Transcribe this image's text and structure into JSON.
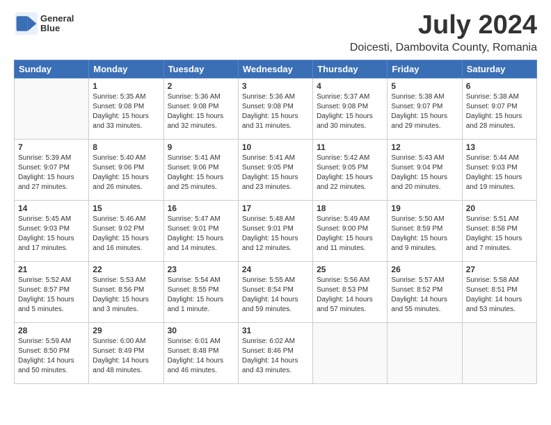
{
  "header": {
    "logo_line1": "General",
    "logo_line2": "Blue",
    "title": "July 2024",
    "subtitle": "Doicesti, Dambovita County, Romania"
  },
  "weekdays": [
    "Sunday",
    "Monday",
    "Tuesday",
    "Wednesday",
    "Thursday",
    "Friday",
    "Saturday"
  ],
  "weeks": [
    [
      {
        "day": "",
        "info": ""
      },
      {
        "day": "1",
        "info": "Sunrise: 5:35 AM\nSunset: 9:08 PM\nDaylight: 15 hours\nand 33 minutes."
      },
      {
        "day": "2",
        "info": "Sunrise: 5:36 AM\nSunset: 9:08 PM\nDaylight: 15 hours\nand 32 minutes."
      },
      {
        "day": "3",
        "info": "Sunrise: 5:36 AM\nSunset: 9:08 PM\nDaylight: 15 hours\nand 31 minutes."
      },
      {
        "day": "4",
        "info": "Sunrise: 5:37 AM\nSunset: 9:08 PM\nDaylight: 15 hours\nand 30 minutes."
      },
      {
        "day": "5",
        "info": "Sunrise: 5:38 AM\nSunset: 9:07 PM\nDaylight: 15 hours\nand 29 minutes."
      },
      {
        "day": "6",
        "info": "Sunrise: 5:38 AM\nSunset: 9:07 PM\nDaylight: 15 hours\nand 28 minutes."
      }
    ],
    [
      {
        "day": "7",
        "info": "Sunrise: 5:39 AM\nSunset: 9:07 PM\nDaylight: 15 hours\nand 27 minutes."
      },
      {
        "day": "8",
        "info": "Sunrise: 5:40 AM\nSunset: 9:06 PM\nDaylight: 15 hours\nand 26 minutes."
      },
      {
        "day": "9",
        "info": "Sunrise: 5:41 AM\nSunset: 9:06 PM\nDaylight: 15 hours\nand 25 minutes."
      },
      {
        "day": "10",
        "info": "Sunrise: 5:41 AM\nSunset: 9:05 PM\nDaylight: 15 hours\nand 23 minutes."
      },
      {
        "day": "11",
        "info": "Sunrise: 5:42 AM\nSunset: 9:05 PM\nDaylight: 15 hours\nand 22 minutes."
      },
      {
        "day": "12",
        "info": "Sunrise: 5:43 AM\nSunset: 9:04 PM\nDaylight: 15 hours\nand 20 minutes."
      },
      {
        "day": "13",
        "info": "Sunrise: 5:44 AM\nSunset: 9:03 PM\nDaylight: 15 hours\nand 19 minutes."
      }
    ],
    [
      {
        "day": "14",
        "info": "Sunrise: 5:45 AM\nSunset: 9:03 PM\nDaylight: 15 hours\nand 17 minutes."
      },
      {
        "day": "15",
        "info": "Sunrise: 5:46 AM\nSunset: 9:02 PM\nDaylight: 15 hours\nand 16 minutes."
      },
      {
        "day": "16",
        "info": "Sunrise: 5:47 AM\nSunset: 9:01 PM\nDaylight: 15 hours\nand 14 minutes."
      },
      {
        "day": "17",
        "info": "Sunrise: 5:48 AM\nSunset: 9:01 PM\nDaylight: 15 hours\nand 12 minutes."
      },
      {
        "day": "18",
        "info": "Sunrise: 5:49 AM\nSunset: 9:00 PM\nDaylight: 15 hours\nand 11 minutes."
      },
      {
        "day": "19",
        "info": "Sunrise: 5:50 AM\nSunset: 8:59 PM\nDaylight: 15 hours\nand 9 minutes."
      },
      {
        "day": "20",
        "info": "Sunrise: 5:51 AM\nSunset: 8:58 PM\nDaylight: 15 hours\nand 7 minutes."
      }
    ],
    [
      {
        "day": "21",
        "info": "Sunrise: 5:52 AM\nSunset: 8:57 PM\nDaylight: 15 hours\nand 5 minutes."
      },
      {
        "day": "22",
        "info": "Sunrise: 5:53 AM\nSunset: 8:56 PM\nDaylight: 15 hours\nand 3 minutes."
      },
      {
        "day": "23",
        "info": "Sunrise: 5:54 AM\nSunset: 8:55 PM\nDaylight: 15 hours\nand 1 minute."
      },
      {
        "day": "24",
        "info": "Sunrise: 5:55 AM\nSunset: 8:54 PM\nDaylight: 14 hours\nand 59 minutes."
      },
      {
        "day": "25",
        "info": "Sunrise: 5:56 AM\nSunset: 8:53 PM\nDaylight: 14 hours\nand 57 minutes."
      },
      {
        "day": "26",
        "info": "Sunrise: 5:57 AM\nSunset: 8:52 PM\nDaylight: 14 hours\nand 55 minutes."
      },
      {
        "day": "27",
        "info": "Sunrise: 5:58 AM\nSunset: 8:51 PM\nDaylight: 14 hours\nand 53 minutes."
      }
    ],
    [
      {
        "day": "28",
        "info": "Sunrise: 5:59 AM\nSunset: 8:50 PM\nDaylight: 14 hours\nand 50 minutes."
      },
      {
        "day": "29",
        "info": "Sunrise: 6:00 AM\nSunset: 8:49 PM\nDaylight: 14 hours\nand 48 minutes."
      },
      {
        "day": "30",
        "info": "Sunrise: 6:01 AM\nSunset: 8:48 PM\nDaylight: 14 hours\nand 46 minutes."
      },
      {
        "day": "31",
        "info": "Sunrise: 6:02 AM\nSunset: 8:46 PM\nDaylight: 14 hours\nand 43 minutes."
      },
      {
        "day": "",
        "info": ""
      },
      {
        "day": "",
        "info": ""
      },
      {
        "day": "",
        "info": ""
      }
    ]
  ]
}
